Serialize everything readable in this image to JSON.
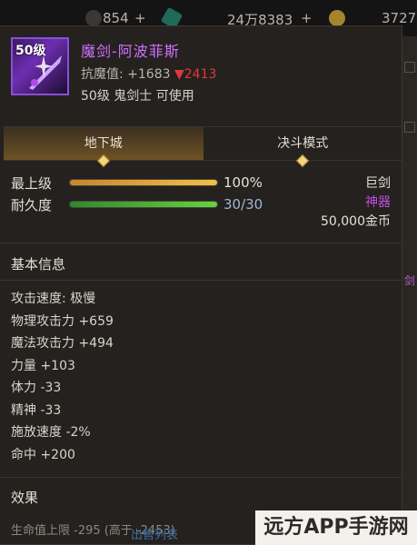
{
  "hud": {
    "values": [
      "854",
      "24万8383",
      "3727"
    ],
    "plus": "+"
  },
  "item": {
    "level_badge": "50级",
    "name": "魔剑-阿波菲斯",
    "resist_label": "抗魔值: +1683",
    "resist_diff": "▼2413",
    "requirement": "50级 鬼剑士 可使用",
    "name_color": "#d070ff"
  },
  "tabs": [
    {
      "label": "地下城",
      "active": true
    },
    {
      "label": "决斗模式",
      "active": false
    }
  ],
  "stats": {
    "max_level": {
      "label": "最上级",
      "value": "100%",
      "fill": 1.0
    },
    "durability": {
      "label": "耐久度",
      "value": "30/30",
      "fill": 1.0
    }
  },
  "right_info": {
    "type": "巨剑",
    "rarity": "神器",
    "price": "50,000金币",
    "rarity_color": "#c04ee0"
  },
  "sections": {
    "basic": "基本信息",
    "effects": "效果"
  },
  "attributes": [
    "攻击速度: 极慢",
    "物理攻击力 +659",
    "魔法攻击力 +494",
    "力量 +103",
    "体力 -33",
    "精神 -33",
    "施放速度 -2%",
    "命中 +200"
  ],
  "truncated_line": "生命值上限 -295 (高于 -2453)",
  "side_text": "剑",
  "watermark": "远方APP手游网",
  "ghost_button": "出售列表"
}
